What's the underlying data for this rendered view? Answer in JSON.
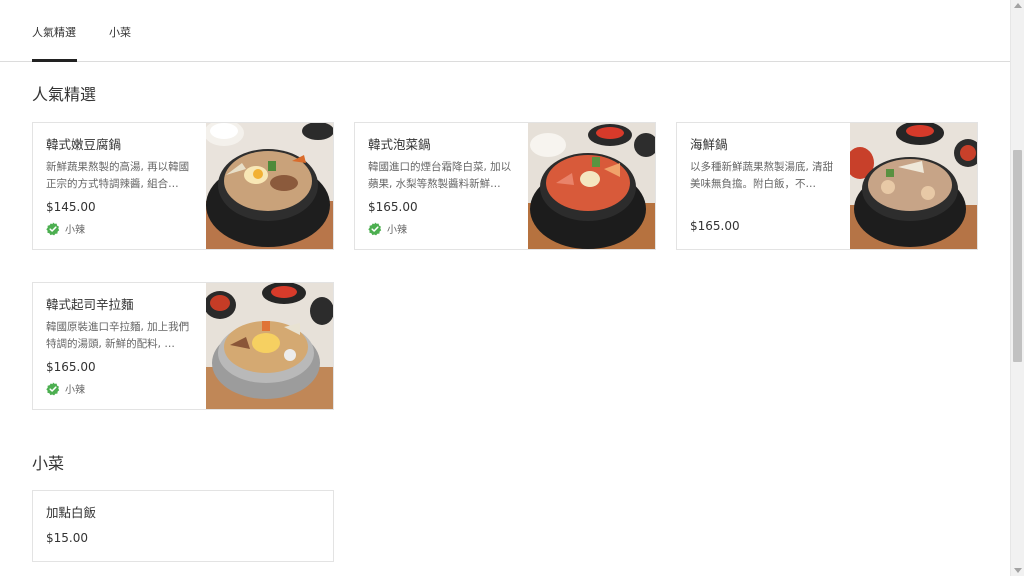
{
  "tabs": [
    {
      "label": "人氣精選",
      "active": true
    },
    {
      "label": "小菜",
      "active": false
    }
  ],
  "sections": [
    {
      "title": "人氣精選"
    },
    {
      "title": "小菜"
    }
  ],
  "items": [
    {
      "name": "韓式嫩豆腐鍋",
      "desc": "新鮮蔬果熬製的高湯, 再以韓國正宗的方式特調辣醬, 組合…",
      "price": "$145.00",
      "badge": "小辣"
    },
    {
      "name": "韓式泡菜鍋",
      "desc": "韓國進口的煙台霜降白菜, 加以蘋果, 水梨等熬製醬料新鮮…",
      "price": "$165.00",
      "badge": "小辣"
    },
    {
      "name": "海鮮鍋",
      "desc": "以多種新鮮蔬果熬製湯底, 清甜美味無負擔。附白飯，不…",
      "price": "$165.00"
    },
    {
      "name": "韓式起司辛拉麵",
      "desc": "韓國原裝進口辛拉麵, 加上我們特調的湯頭, 新鮮的配料, …",
      "price": "$165.00",
      "badge": "小辣"
    },
    {
      "name": "加點白飯",
      "price": "$15.00"
    }
  ],
  "colors": {
    "badge_green": "#4caf50",
    "text": "#333333",
    "muted": "#666666"
  },
  "icons": {
    "badge": "check-circle-icon"
  }
}
